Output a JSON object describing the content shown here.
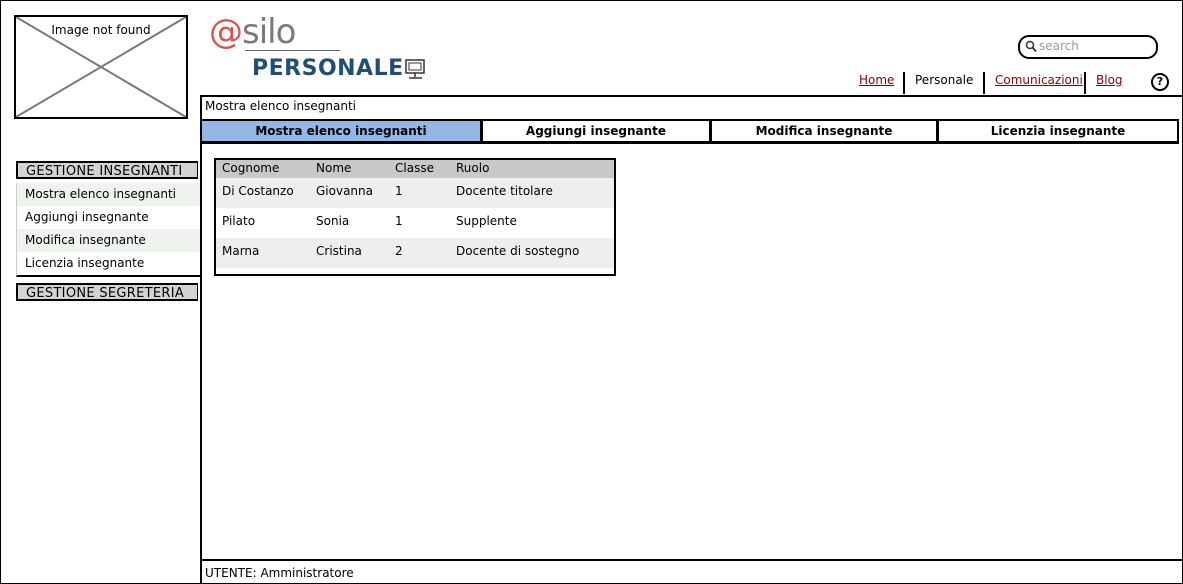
{
  "image_placeholder": {
    "caption": "Image not found"
  },
  "logo": {
    "at": "@",
    "silo": "silo"
  },
  "section_title": "PERSONALE",
  "search": {
    "placeholder": "search"
  },
  "topnav": {
    "home": "Home",
    "personale": "Personale",
    "comunicazioni": "Comunicazioni",
    "blog": "Blog"
  },
  "help": {
    "label": "?"
  },
  "breadcrumb": "Mostra elenco insegnanti",
  "tabs": [
    {
      "label": "Mostra elenco insegnanti",
      "active": true
    },
    {
      "label": "Aggiungi insegnante",
      "active": false
    },
    {
      "label": "Modifica insegnante",
      "active": false
    },
    {
      "label": "Licenzia insegnante",
      "active": false
    }
  ],
  "sidebar": {
    "group1": "GESTIONE INSEGNANTI",
    "items": [
      {
        "label": "Mostra elenco insegnanti"
      },
      {
        "label": "Aggiungi insegnante"
      },
      {
        "label": "Modifica insegnante"
      },
      {
        "label": "Licenzia insegnante"
      }
    ],
    "group2": "GESTIONE SEGRETERIA"
  },
  "table": {
    "headers": [
      "Cognome",
      "Nome",
      "Classe",
      "Ruolo"
    ],
    "rows": [
      [
        "Di Costanzo",
        "Giovanna",
        "1",
        "Docente titolare"
      ],
      [
        "Pilato",
        "Sonia",
        "1",
        "Supplente"
      ],
      [
        "Marna",
        "Cristina",
        "2",
        "Docente di sostegno"
      ]
    ]
  },
  "footer": "UTENTE: Amministratore",
  "colors": {
    "active_tab": "#93b8e8",
    "link": "#8b0000",
    "section_title": "#1f4e79",
    "logo_at": "#d9534f"
  }
}
